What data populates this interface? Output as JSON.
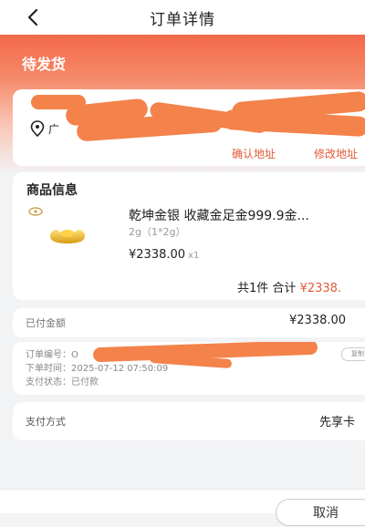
{
  "header": {
    "title": "订单详情"
  },
  "status": {
    "text": "待发货"
  },
  "address": {
    "line2_prefix": "广",
    "confirm_label": "确认地址",
    "modify_label": "修改地址"
  },
  "product": {
    "section_title": "商品信息",
    "name": "乾坤金银 收藏金足金999.9金...",
    "spec": "2g（1*2g）",
    "price": "¥2338.00",
    "qty": "x1",
    "count_text": "共1件",
    "total_label": "合计",
    "total_amount": "¥2338."
  },
  "paid": {
    "label": "已付金额",
    "amount": "¥2338.00"
  },
  "order": {
    "number_label": "订单编号：",
    "number_value": "O",
    "time_label": "下单时间：",
    "time_value": "2025-07-12 07:50:09",
    "status_label": "支付状态：",
    "status_value": "已付款",
    "copy_label": "复制"
  },
  "payment": {
    "label": "支付方式",
    "value": "先享卡"
  },
  "footer": {
    "cancel_label": "取消"
  },
  "colors": {
    "accent": "#e25a35",
    "hero": "#f3694a",
    "redaction": "#f4824b"
  }
}
